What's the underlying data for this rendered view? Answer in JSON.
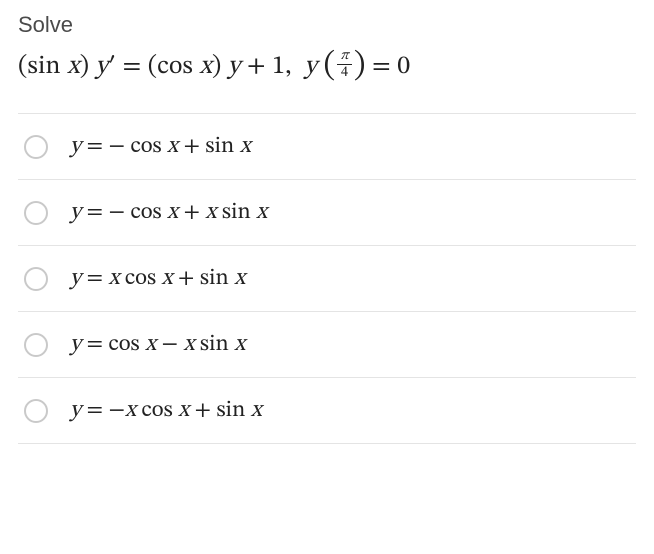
{
  "prompt": "Solve",
  "equation_html": "(sin <span class='math-i'>x</span>) <span class='math-i'>y</span>′ = (cos <span class='math-i'>x</span>) <span class='math-i'>y</span> + 1, &nbsp;<span class='math-i'>y</span> <span class='paren-lg'>(</span><span class='frac'><span class='num'><span class='math-i'>π</span></span><span class='den'>4</span></span><span class='paren-lg'>)</span> = 0",
  "options": [
    "<span class='math-i'>y</span> = − cos <span class='math-i'>x</span> + sin <span class='math-i'>x</span>",
    "<span class='math-i'>y</span> = − cos <span class='math-i'>x</span> + <span class='math-i'>x</span> sin <span class='math-i'>x</span>",
    "<span class='math-i'>y</span> = <span class='math-i'>x</span> cos <span class='math-i'>x</span> + sin <span class='math-i'>x</span>",
    "<span class='math-i'>y</span> = cos <span class='math-i'>x</span> − <span class='math-i'>x</span> sin <span class='math-i'>x</span>",
    "<span class='math-i'>y</span> = −<span class='math-i'>x</span> cos <span class='math-i'>x</span> + sin <span class='math-i'>x</span>"
  ]
}
